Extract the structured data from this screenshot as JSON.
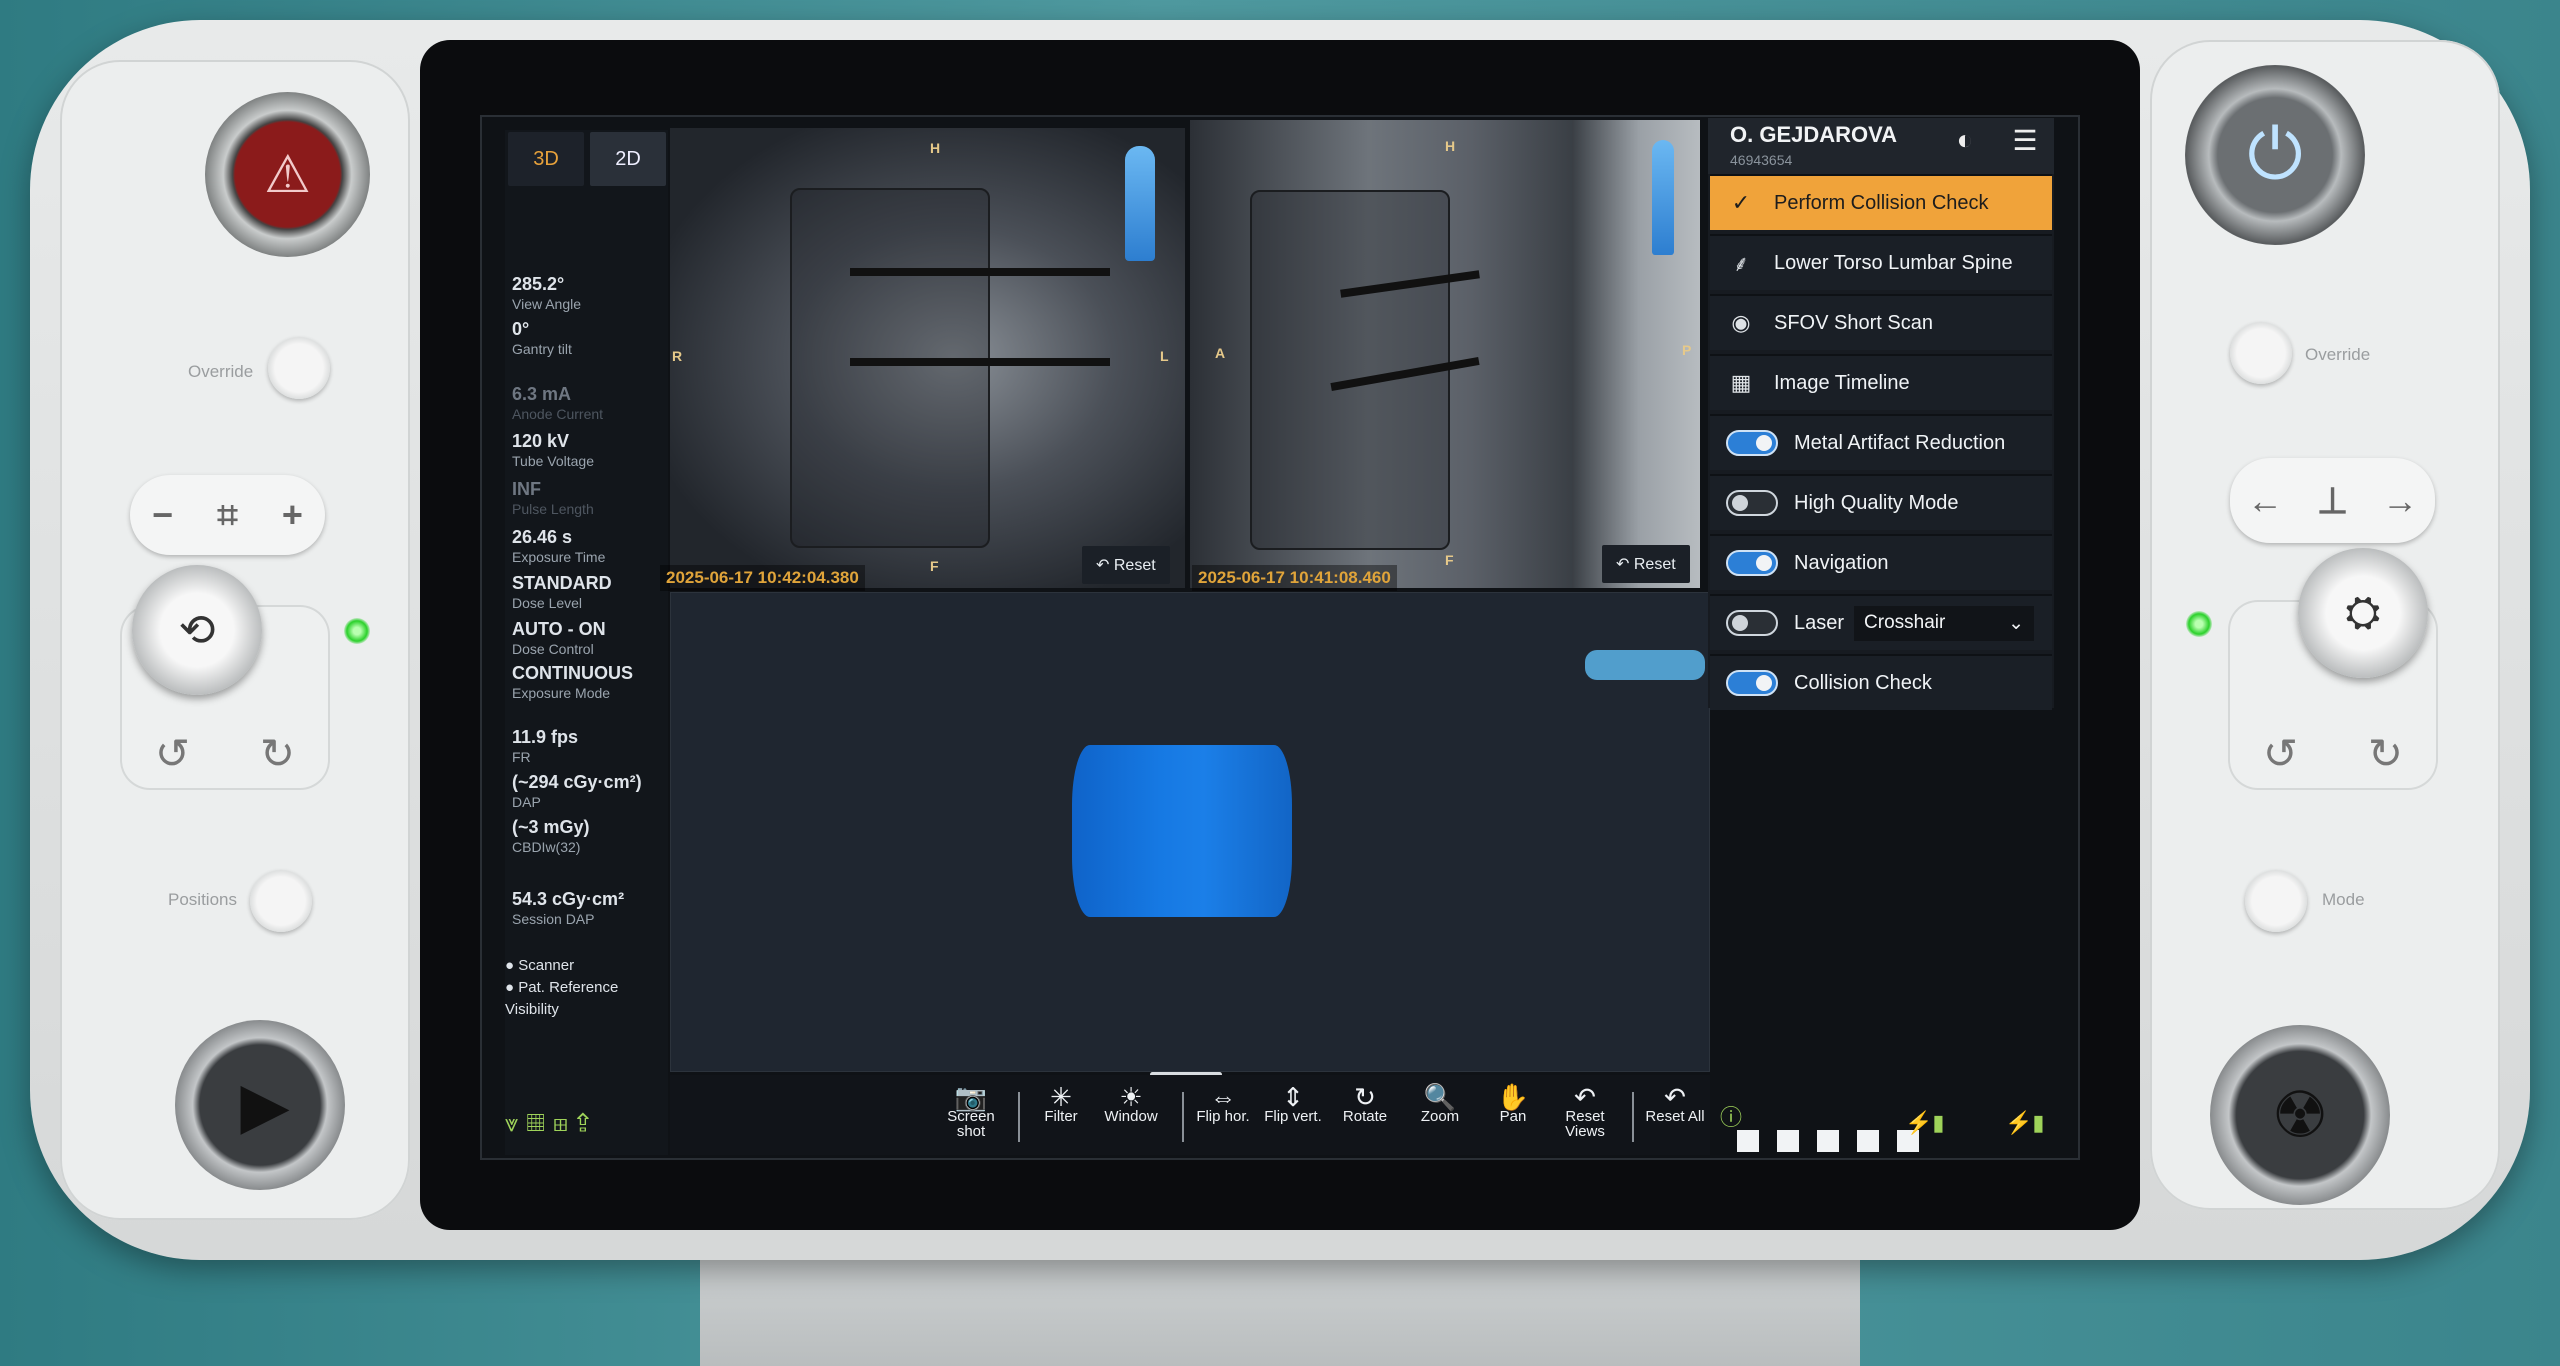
{
  "hardware": {
    "left_override_label": "Override",
    "right_override_label": "Override",
    "positions_label": "Positions",
    "mode_label": "Mode"
  },
  "tabs": [
    {
      "label": "3D",
      "active": true
    },
    {
      "label": "2D",
      "active": false
    }
  ],
  "parameters": [
    {
      "value": "285.2°",
      "label": "View Angle",
      "dim": false
    },
    {
      "value": "0°",
      "label": "Gantry tilt",
      "dim": false
    },
    {
      "value": "6.3 mA",
      "label": "Anode Current",
      "dim": true
    },
    {
      "value": "120 kV",
      "label": "Tube Voltage",
      "dim": false
    },
    {
      "value": "INF",
      "label": "Pulse Length",
      "dim": true
    },
    {
      "value": "26.46 s",
      "label": "Exposure Time",
      "dim": false
    },
    {
      "value": "STANDARD",
      "label": "Dose Level",
      "dim": false
    },
    {
      "value": "AUTO - ON",
      "label": "Dose Control",
      "dim": false
    },
    {
      "value": "CONTINUOUS",
      "label": "Exposure Mode",
      "dim": false
    },
    {
      "value": "11.9 fps",
      "label": "FR",
      "dim": false
    },
    {
      "value": "(~294 cGy·cm²)",
      "label": "DAP",
      "dim": false
    },
    {
      "value": "(~3 mGy)",
      "label": "CBDIw(32)",
      "dim": false
    },
    {
      "value": "54.3 cGy·cm²",
      "label": "Session DAP",
      "dim": false
    }
  ],
  "visibility": {
    "items": [
      "Scanner",
      "Pat. Reference"
    ],
    "label": "Visibility"
  },
  "viewers": {
    "top_left": {
      "timestamp": "2025-06-17 10:42:04.380",
      "reset_label": "Reset",
      "orientation": {
        "top": "H",
        "left": "R",
        "right": "L",
        "bottom": "F"
      }
    },
    "top_right": {
      "timestamp": "2025-06-17 10:41:08.460",
      "reset_label": "Reset",
      "orientation": {
        "top": "H",
        "left": "A",
        "right": "P",
        "bottom": "F"
      }
    }
  },
  "user": {
    "name": "O. GEJDAROVA",
    "id": "46943654"
  },
  "menu": [
    {
      "label": "Perform Collision Check",
      "icon": "check-icon",
      "glyph": "✓",
      "active": true
    },
    {
      "label": "Lower Torso Lumbar Spine",
      "icon": "spine-icon",
      "glyph": "⸙"
    },
    {
      "label": "SFOV Short Scan",
      "icon": "scan-icon",
      "glyph": "◉"
    },
    {
      "label": "Image Timeline",
      "icon": "grid-icon",
      "glyph": "▦"
    }
  ],
  "toggles": [
    {
      "label": "Metal Artifact Reduction",
      "on": true
    },
    {
      "label": "High Quality Mode",
      "on": false
    },
    {
      "label": "Navigation",
      "on": true
    },
    {
      "label": "Laser",
      "on": false,
      "select": "Crosshair"
    },
    {
      "label": "Collision Check",
      "on": true
    }
  ],
  "toolbar": [
    {
      "label": "Screen shot",
      "icon": "camera-icon",
      "glyph": "📷"
    },
    {
      "label": "Filter",
      "icon": "filter-icon",
      "glyph": "✳"
    },
    {
      "label": "Window",
      "icon": "window-icon",
      "glyph": "☀"
    },
    {
      "label": "Flip hor.",
      "icon": "flip-horizontal-icon",
      "glyph": "⇔"
    },
    {
      "label": "Flip vert.",
      "icon": "flip-vertical-icon",
      "glyph": "⇕"
    },
    {
      "label": "Rotate",
      "icon": "rotate-icon",
      "glyph": "↻"
    },
    {
      "label": "Zoom",
      "icon": "zoom-icon",
      "glyph": "🔍"
    },
    {
      "label": "Pan",
      "icon": "pan-icon",
      "glyph": "✋"
    },
    {
      "label": "Reset Views",
      "icon": "reset-views-icon",
      "glyph": "↶"
    },
    {
      "label": "Reset All",
      "icon": "reset-all-icon",
      "glyph": "↶"
    }
  ],
  "colors": {
    "accent": "#f0a33a",
    "toggle_on": "#2c7fd6",
    "status_green": "#9fd35a"
  }
}
